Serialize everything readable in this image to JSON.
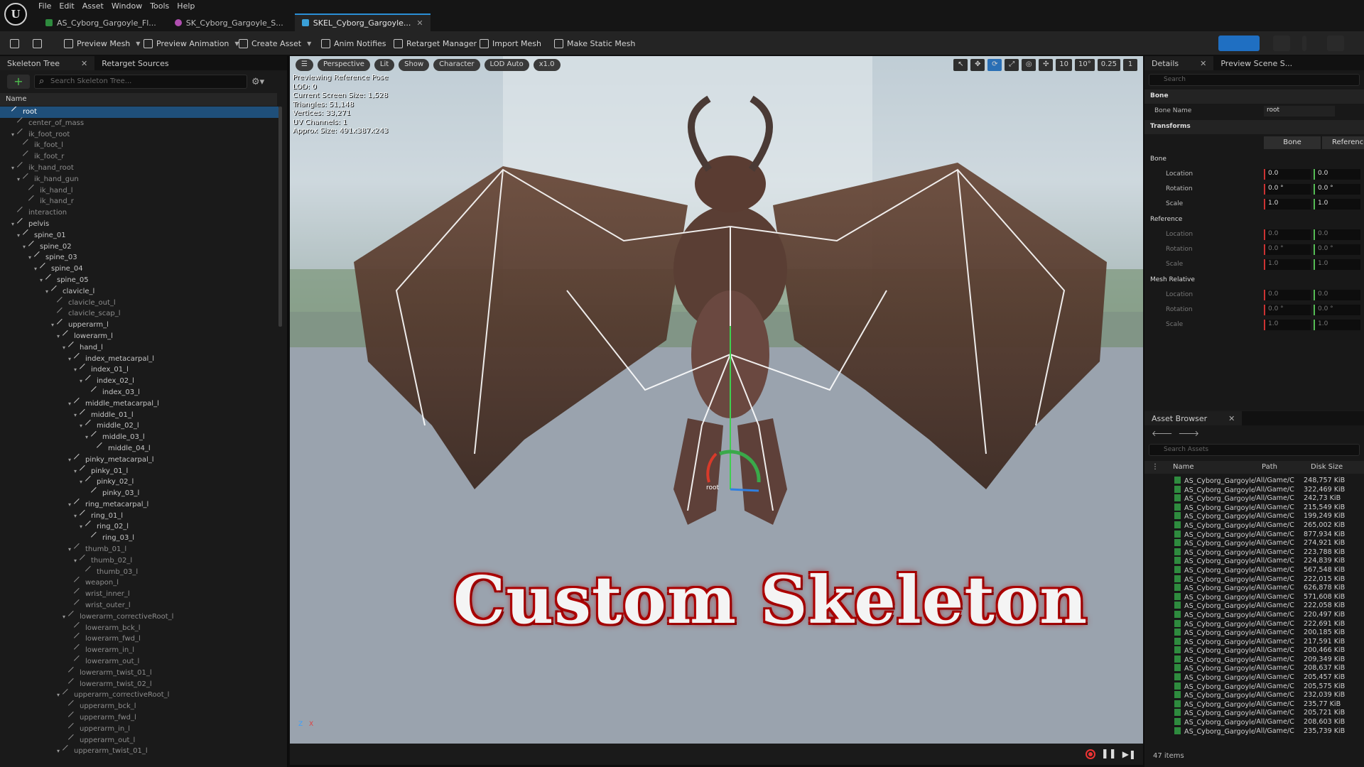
{
  "menu": [
    "File",
    "Edit",
    "Asset",
    "Window",
    "Tools",
    "Help"
  ],
  "tabs": [
    {
      "label": "AS_Cyborg_Gargoyle_Fl...",
      "color": "#2e8b3e"
    },
    {
      "label": "SK_Cyborg_Gargoyle_S...",
      "color": "#b04fb0"
    },
    {
      "label": "SKEL_Cyborg_Gargoyle...",
      "color": "#3aa0d8"
    }
  ],
  "toolbar": {
    "preview_mesh": "Preview Mesh",
    "preview_animation": "Preview Animation",
    "create_asset": "Create Asset",
    "anim_notifies": "Anim Notifies",
    "retarget_manager": "Retarget Manager",
    "import_mesh": "Import Mesh",
    "make_static_mesh": "Make Static Mesh"
  },
  "left_panel": {
    "tab_skeleton_tree": "Skeleton Tree",
    "tab_retarget_sources": "Retarget Sources",
    "search_placeholder": "Search Skeleton Tree...",
    "column_name": "Name",
    "bones": [
      {
        "name": "root",
        "depth": 0,
        "sel": true
      },
      {
        "name": "center_of_mass",
        "depth": 1,
        "dim": true
      },
      {
        "name": "ik_foot_root",
        "depth": 1,
        "dim": true,
        "exp": true
      },
      {
        "name": "ik_foot_l",
        "depth": 2,
        "dim": true
      },
      {
        "name": "ik_foot_r",
        "depth": 2,
        "dim": true
      },
      {
        "name": "ik_hand_root",
        "depth": 1,
        "dim": true,
        "exp": true
      },
      {
        "name": "ik_hand_gun",
        "depth": 2,
        "dim": true,
        "exp": true
      },
      {
        "name": "ik_hand_l",
        "depth": 3,
        "dim": true
      },
      {
        "name": "ik_hand_r",
        "depth": 3,
        "dim": true
      },
      {
        "name": "interaction",
        "depth": 1,
        "dim": true
      },
      {
        "name": "pelvis",
        "depth": 1,
        "exp": true
      },
      {
        "name": "spine_01",
        "depth": 2,
        "exp": true
      },
      {
        "name": "spine_02",
        "depth": 3,
        "exp": true
      },
      {
        "name": "spine_03",
        "depth": 4,
        "exp": true
      },
      {
        "name": "spine_04",
        "depth": 5,
        "exp": true
      },
      {
        "name": "spine_05",
        "depth": 6,
        "exp": true
      },
      {
        "name": "clavicle_l",
        "depth": 7,
        "exp": true
      },
      {
        "name": "clavicle_out_l",
        "depth": 8,
        "dim": true
      },
      {
        "name": "clavicle_scap_l",
        "depth": 8,
        "dim": true
      },
      {
        "name": "upperarm_l",
        "depth": 8,
        "exp": true
      },
      {
        "name": "lowerarm_l",
        "depth": 9,
        "exp": true
      },
      {
        "name": "hand_l",
        "depth": 10,
        "exp": true
      },
      {
        "name": "index_metacarpal_l",
        "depth": 11,
        "exp": true
      },
      {
        "name": "index_01_l",
        "depth": 12,
        "exp": true
      },
      {
        "name": "index_02_l",
        "depth": 13,
        "exp": true
      },
      {
        "name": "index_03_l",
        "depth": 14
      },
      {
        "name": "middle_metacarpal_l",
        "depth": 11,
        "exp": true
      },
      {
        "name": "middle_01_l",
        "depth": 12,
        "exp": true
      },
      {
        "name": "middle_02_l",
        "depth": 13,
        "exp": true
      },
      {
        "name": "middle_03_l",
        "depth": 14,
        "exp": true
      },
      {
        "name": "middle_04_l",
        "depth": 15
      },
      {
        "name": "pinky_metacarpal_l",
        "depth": 11,
        "exp": true
      },
      {
        "name": "pinky_01_l",
        "depth": 12,
        "exp": true
      },
      {
        "name": "pinky_02_l",
        "depth": 13,
        "exp": true
      },
      {
        "name": "pinky_03_l",
        "depth": 14
      },
      {
        "name": "ring_metacarpal_l",
        "depth": 11,
        "exp": true
      },
      {
        "name": "ring_01_l",
        "depth": 12,
        "exp": true
      },
      {
        "name": "ring_02_l",
        "depth": 13,
        "exp": true
      },
      {
        "name": "ring_03_l",
        "depth": 14
      },
      {
        "name": "thumb_01_l",
        "depth": 11,
        "dim": true,
        "exp": true
      },
      {
        "name": "thumb_02_l",
        "depth": 12,
        "dim": true,
        "exp": true
      },
      {
        "name": "thumb_03_l",
        "depth": 13,
        "dim": true
      },
      {
        "name": "weapon_l",
        "depth": 11,
        "dim": true
      },
      {
        "name": "wrist_inner_l",
        "depth": 11,
        "dim": true
      },
      {
        "name": "wrist_outer_l",
        "depth": 11,
        "dim": true
      },
      {
        "name": "lowerarm_correctiveRoot_l",
        "depth": 10,
        "dim": true,
        "exp": true
      },
      {
        "name": "lowerarm_bck_l",
        "depth": 11,
        "dim": true
      },
      {
        "name": "lowerarm_fwd_l",
        "depth": 11,
        "dim": true
      },
      {
        "name": "lowerarm_in_l",
        "depth": 11,
        "dim": true
      },
      {
        "name": "lowerarm_out_l",
        "depth": 11,
        "dim": true
      },
      {
        "name": "lowerarm_twist_01_l",
        "depth": 10,
        "dim": true
      },
      {
        "name": "lowerarm_twist_02_l",
        "depth": 10,
        "dim": true
      },
      {
        "name": "upperarm_correctiveRoot_l",
        "depth": 9,
        "dim": true,
        "exp": true
      },
      {
        "name": "upperarm_bck_l",
        "depth": 10,
        "dim": true
      },
      {
        "name": "upperarm_fwd_l",
        "depth": 10,
        "dim": true
      },
      {
        "name": "upperarm_in_l",
        "depth": 10,
        "dim": true
      },
      {
        "name": "upperarm_out_l",
        "depth": 10,
        "dim": true
      },
      {
        "name": "upperarm_twist_01_l",
        "depth": 9,
        "dim": true,
        "exp": true
      }
    ]
  },
  "viewport": {
    "menu_icon": "hamburger-icon",
    "perspective": "Perspective",
    "lit": "Lit",
    "show": "Show",
    "character": "Character",
    "lod": "LOD Auto",
    "play_speed": "x1.0",
    "grid_size": "10",
    "angle_snap": "10°",
    "scale_snap": "0.25",
    "camera_speed": "1",
    "info": [
      "Previewing Reference Pose",
      "LOD: 0",
      "Current Screen Size: 1,528",
      "Triangles: 51,148",
      "Vertices: 33,271",
      "UV Channels: 1",
      "Approx Size: 491x387x243"
    ],
    "root_label": "root",
    "overlay_title": "Custom Skeleton",
    "axis_z": "Z",
    "axis_x": "X"
  },
  "details": {
    "tab": "Details",
    "tab2": "Preview Scene S...",
    "search_placeholder": "Search",
    "section_bone": "Bone",
    "bone_name_label": "Bone Name",
    "bone_name_value": "root",
    "section_transforms": "Transforms",
    "btn_bone": "Bone",
    "btn_reference": "Reference",
    "sub_bone": "Bone",
    "sub_reference": "Reference",
    "sub_mesh_relative": "Mesh Relative",
    "location": "Location",
    "rotation": "Rotation",
    "scale": "Scale",
    "loc_x": "0.0",
    "loc_y": "0.0",
    "rot_x": "0.0 °",
    "rot_y": "0.0 °",
    "scale_x": "1.0",
    "scale_y": "1.0"
  },
  "asset_browser": {
    "tab": "Asset Browser",
    "search_placeholder": "Search Assets",
    "col_name": "Name",
    "col_path": "Path",
    "col_size": "Disk Size",
    "item_count": "47 items",
    "items": [
      [
        "AS_Cyborg_Gargoyle_A",
        "/All/Game/C",
        "248,757 KiB"
      ],
      [
        "AS_Cyborg_Gargoyle_A",
        "/All/Game/C",
        "322,469 KiB"
      ],
      [
        "AS_Cyborg_Gargoyle_A",
        "/All/Game/C",
        "242,73 KiB"
      ],
      [
        "AS_Cyborg_Gargoyle_D",
        "/All/Game/C",
        "215,549 KiB"
      ],
      [
        "AS_Cyborg_Gargoyle_D",
        "/All/Game/C",
        "199,249 KiB"
      ],
      [
        "AS_Cyborg_Gargoyle_F",
        "/All/Game/C",
        "265,002 KiB"
      ],
      [
        "AS_Cyborg_Gargoyle_F",
        "/All/Game/C",
        "877,934 KiB"
      ],
      [
        "AS_Cyborg_Gargoyle_F",
        "/All/Game/C",
        "274,921 KiB"
      ],
      [
        "AS_Cyborg_Gargoyle_F",
        "/All/Game/C",
        "223,788 KiB"
      ],
      [
        "AS_Cyborg_Gargoyle_F",
        "/All/Game/C",
        "224,839 KiB"
      ],
      [
        "AS_Cyborg_Gargoyle_F",
        "/All/Game/C",
        "567,548 KiB"
      ],
      [
        "AS_Cyborg_Gargoyle_F",
        "/All/Game/C",
        "222,015 KiB"
      ],
      [
        "AS_Cyborg_Gargoyle_F",
        "/All/Game/C",
        "626,878 KiB"
      ],
      [
        "AS_Cyborg_Gargoyle_F",
        "/All/Game/C",
        "571,608 KiB"
      ],
      [
        "AS_Cyborg_Gargoyle_F",
        "/All/Game/C",
        "222,058 KiB"
      ],
      [
        "AS_Cyborg_Gargoyle_F",
        "/All/Game/C",
        "220,497 KiB"
      ],
      [
        "AS_Cyborg_Gargoyle_F",
        "/All/Game/C",
        "222,691 KiB"
      ],
      [
        "AS_Cyborg_Gargoyle_F",
        "/All/Game/C",
        "200,185 KiB"
      ],
      [
        "AS_Cyborg_Gargoyle_F",
        "/All/Game/C",
        "217,591 KiB"
      ],
      [
        "AS_Cyborg_Gargoyle_F",
        "/All/Game/C",
        "200,466 KiB"
      ],
      [
        "AS_Cyborg_Gargoyle_F",
        "/All/Game/C",
        "209,349 KiB"
      ],
      [
        "AS_Cyborg_Gargoyle_F",
        "/All/Game/C",
        "208,637 KiB"
      ],
      [
        "AS_Cyborg_Gargoyle_F",
        "/All/Game/C",
        "205,457 KiB"
      ],
      [
        "AS_Cyborg_Gargoyle_F",
        "/All/Game/C",
        "205,575 KiB"
      ],
      [
        "AS_Cyborg_Gargoyle_F",
        "/All/Game/C",
        "232,039 KiB"
      ],
      [
        "AS_Cyborg_Gargoyle_F",
        "/All/Game/C",
        "235,77 KiB"
      ],
      [
        "AS_Cyborg_Gargoyle_F",
        "/All/Game/C",
        "205,721 KiB"
      ],
      [
        "AS_Cyborg_Gargoyle_F",
        "/All/Game/C",
        "208,603 KiB"
      ],
      [
        "AS_Cyborg_Gargoyle_G",
        "/All/Game/C",
        "235,739 KiB"
      ]
    ]
  }
}
